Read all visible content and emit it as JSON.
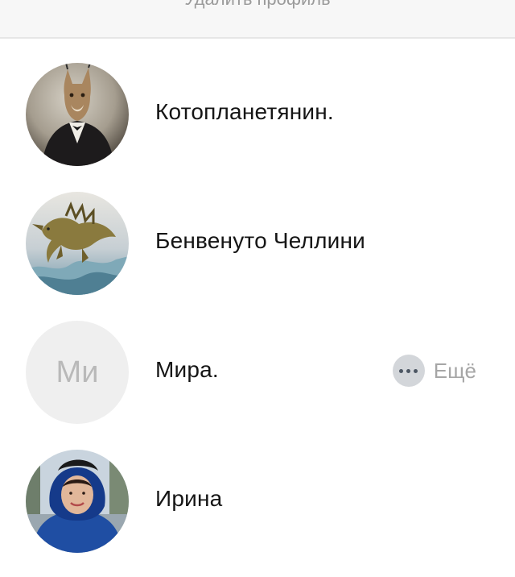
{
  "header": {
    "delete_profile_label": "Удалить профиль"
  },
  "users": [
    {
      "name": "Котопланетянин.",
      "avatar": "caracal-in-tuxedo-image"
    },
    {
      "name": "Бенвенуто Челлини",
      "avatar": "sea-dragon-image"
    },
    {
      "name": "Мира.",
      "avatar_initials": "Ми",
      "more_label": "Ещё",
      "more_icon": "ellipsis-icon"
    },
    {
      "name": "Ирина",
      "avatar": "woman-in-blue-hood-image"
    }
  ],
  "colors": {
    "muted_text": "#a6a6a6",
    "initials_bg": "#efefef",
    "dots_bg": "#d3d6da"
  }
}
